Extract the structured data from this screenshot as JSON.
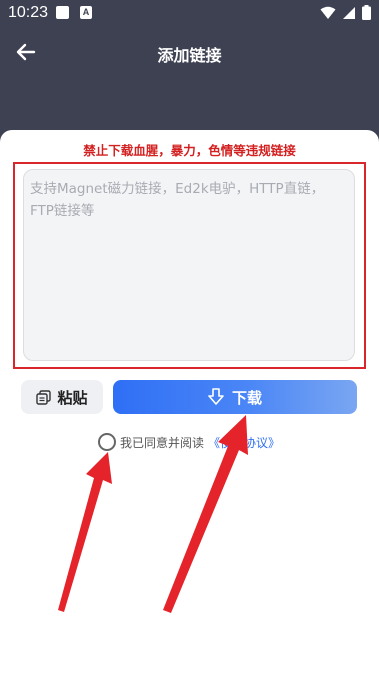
{
  "status_bar": {
    "time": "10:23",
    "a_icon": "A"
  },
  "header": {
    "title": "添加链接",
    "back_icon": "arrow-left-icon"
  },
  "warning": "禁止下载血腥，暴力，色情等违规链接",
  "input": {
    "placeholder": "支持Magnet磁力链接，Ed2k电驴，HTTP直链，FTP链接等"
  },
  "buttons": {
    "paste_label": "粘贴",
    "download_label": "下载"
  },
  "agreement": {
    "text": "我已同意并阅读",
    "link": "《使用协议》"
  },
  "colors": {
    "header_bg": "#3d4152",
    "accent": "#2f6ff5",
    "warning": "#d32020",
    "annotation_red": "#e5232a"
  }
}
